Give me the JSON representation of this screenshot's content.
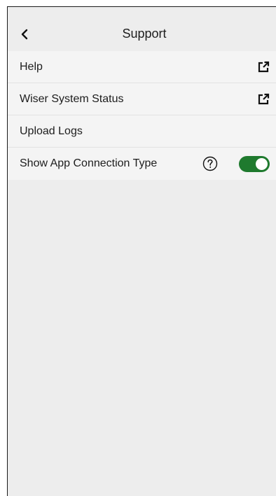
{
  "header": {
    "title": "Support",
    "back_icon": "chevron-left-icon"
  },
  "rows": [
    {
      "label": "Help",
      "icon": "external-link-icon"
    },
    {
      "label": "Wiser System Status",
      "icon": "external-link-icon"
    },
    {
      "label": "Upload Logs"
    },
    {
      "label": "Show App Connection Type",
      "info_icon": "question-circle-icon",
      "toggle_on": true
    }
  ],
  "colors": {
    "background": "#ededed",
    "list_background": "#f4f4f4",
    "toggle_on": "#1f7a2e",
    "text": "#1d1d1d"
  }
}
